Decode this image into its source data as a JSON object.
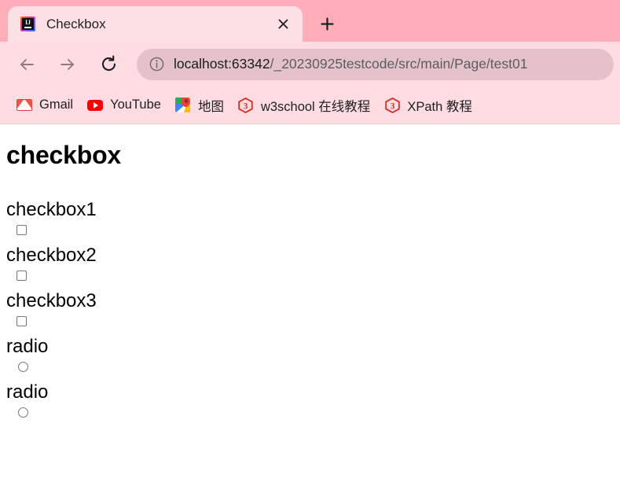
{
  "browser": {
    "tab": {
      "title": "Checkbox",
      "favicon_name": "intellij-idea-favicon",
      "favicon_text": "IJ",
      "close_label": "×"
    },
    "new_tab_label": "+",
    "toolbar": {
      "back_label": "←",
      "forward_label": "→",
      "reload_label": "↻",
      "site_info_label": "ⓘ",
      "url_host": "localhost:63342",
      "url_path": "/_20230925testcode/src/main/Page/test01",
      "url_full": "localhost:63342/_20230925testcode/src/main/Page/test01"
    },
    "bookmarks": [
      {
        "label": "Gmail",
        "icon": "gmail-icon"
      },
      {
        "label": "YouTube",
        "icon": "youtube-icon"
      },
      {
        "label": "地图",
        "icon": "google-maps-icon"
      },
      {
        "label": "w3school 在线教程",
        "icon": "w3school-icon"
      },
      {
        "label": "XPath 教程",
        "icon": "w3school-icon"
      }
    ]
  },
  "page": {
    "heading": "checkbox",
    "fields": [
      {
        "label": "checkbox1",
        "type": "checkbox",
        "checked": false
      },
      {
        "label": "checkbox2",
        "type": "checkbox",
        "checked": false
      },
      {
        "label": "checkbox3",
        "type": "checkbox",
        "checked": false
      },
      {
        "label": "radio",
        "type": "radio",
        "checked": false
      },
      {
        "label": "radio",
        "type": "radio",
        "checked": false
      }
    ]
  },
  "colors": {
    "tab_strip": "#ffadb9",
    "tab_active": "#fde0e4",
    "toolbar": "#fddde2",
    "omnibox": "#e3c3c9",
    "page_bg": "#ffffff",
    "brand_red": "#e8342c"
  }
}
